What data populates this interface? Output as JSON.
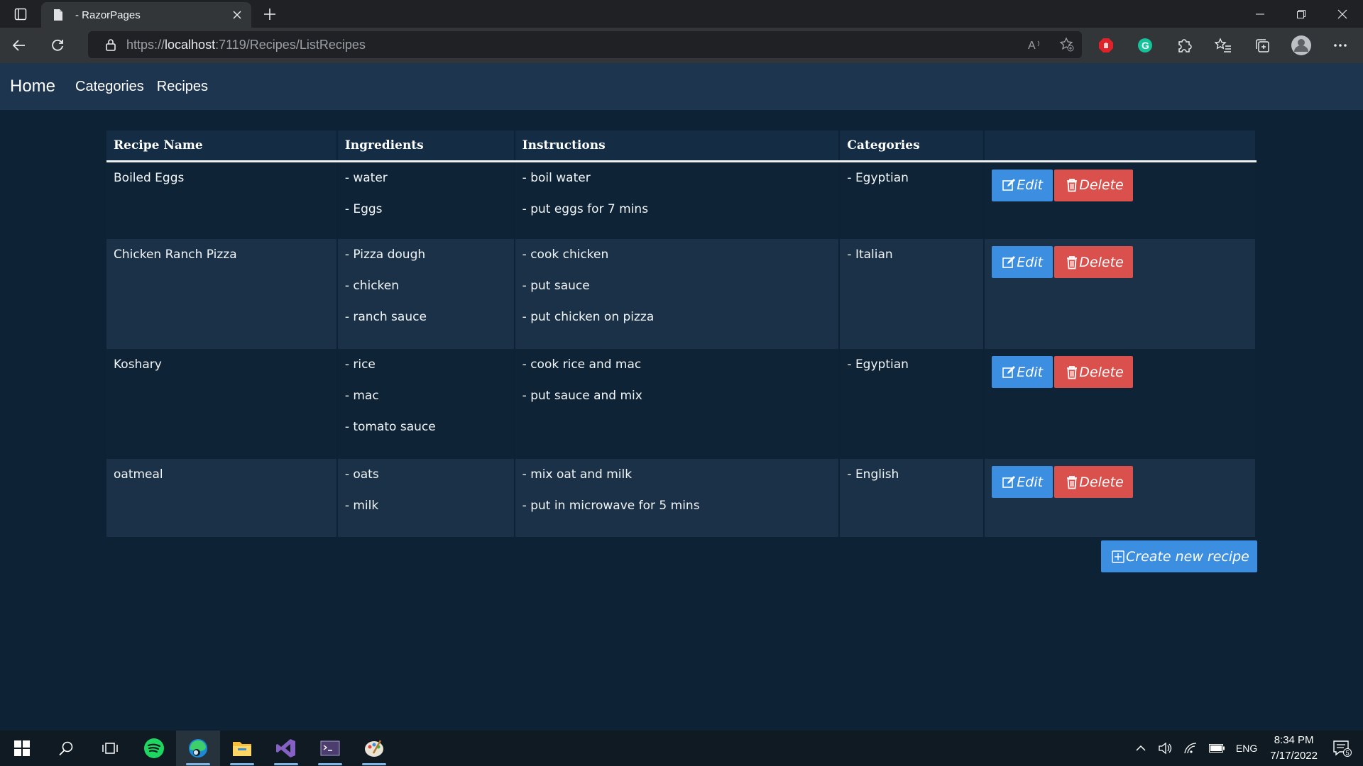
{
  "browser": {
    "tab_title": "- RazorPages",
    "url_prefix": "https://",
    "url_host": "localhost",
    "url_path": ":7119/Recipes/ListRecipes",
    "extension_badge": "G"
  },
  "site": {
    "brand": "Home",
    "nav": [
      "Categories",
      "Recipes"
    ]
  },
  "table": {
    "headers": [
      "Recipe Name",
      "Ingredients",
      "Instructions",
      "Categories",
      ""
    ],
    "rows": [
      {
        "name": "Boiled Eggs",
        "ingredients": [
          "- water",
          "- Eggs"
        ],
        "instructions": [
          "- boil water",
          "- put eggs for 7 mins"
        ],
        "categories": [
          "- Egyptian"
        ]
      },
      {
        "name": "Chicken Ranch Pizza",
        "ingredients": [
          "- Pizza dough",
          "- chicken",
          "- ranch sauce"
        ],
        "instructions": [
          "- cook chicken",
          "- put sauce",
          "- put chicken on pizza"
        ],
        "categories": [
          "- Italian"
        ]
      },
      {
        "name": "Koshary",
        "ingredients": [
          "- rice",
          "- mac",
          "- tomato sauce"
        ],
        "instructions": [
          "- cook rice and mac",
          "- put sauce and mix"
        ],
        "categories": [
          "- Egyptian"
        ]
      },
      {
        "name": "oatmeal",
        "ingredients": [
          "- oats",
          "- milk"
        ],
        "instructions": [
          "- mix oat and milk",
          "- put in microwave for 5 mins"
        ],
        "categories": [
          "- English"
        ]
      }
    ],
    "edit_label": "Edit",
    "delete_label": "Delete"
  },
  "create_button": "Create new recipe",
  "taskbar": {
    "apps": [
      "start-icon",
      "search-icon",
      "task-view-icon",
      "spotify-icon",
      "edge-icon",
      "file-explorer-icon",
      "visual-studio-icon",
      "terminal-icon",
      "paint-icon"
    ],
    "lang": "ENG",
    "time": "8:34 PM",
    "date": "7/17/2022",
    "notification_count": "5"
  },
  "colors": {
    "page_bg": "#0e2236",
    "nav_bg": "#1e3550",
    "edit": "#3b8ee0",
    "delete": "#d9504c"
  }
}
